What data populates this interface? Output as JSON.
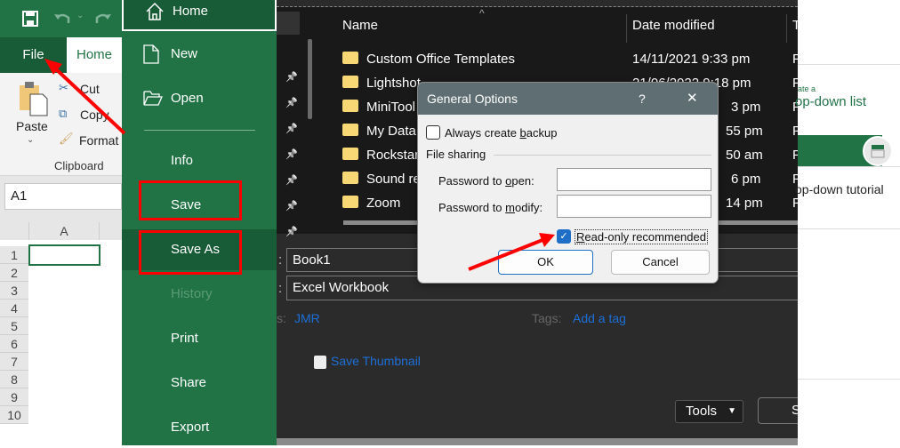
{
  "excel": {
    "tabs": {
      "file": "File",
      "home": "Home"
    },
    "ribbon": {
      "paste": "Paste",
      "cut": "Cut",
      "copy": "Copy",
      "format": "Format",
      "group": "Clipboard"
    },
    "name_box": "A1",
    "column": "A",
    "rows": [
      "1",
      "2",
      "3",
      "4",
      "5",
      "6",
      "7",
      "8",
      "9",
      "10"
    ]
  },
  "backstage": {
    "items": [
      {
        "label": "Home",
        "icon": "home-icon"
      },
      {
        "label": "New",
        "icon": "new-document-icon"
      },
      {
        "label": "Open",
        "icon": "open-folder-icon"
      },
      {
        "label": "Info"
      },
      {
        "label": "Save"
      },
      {
        "label": "Save As"
      },
      {
        "label": "History"
      },
      {
        "label": "Print"
      },
      {
        "label": "Share"
      },
      {
        "label": "Export"
      }
    ],
    "selected": "Save As",
    "accent": "#217346"
  },
  "save_dialog": {
    "columns": {
      "name": "Name",
      "date": "Date modified",
      "type": "T"
    },
    "files": [
      {
        "name": "Custom Office Templates",
        "date": "14/11/2021 9:33 pm",
        "type": "F"
      },
      {
        "name": "Lightshot",
        "date": "21/06/2022 9:18 pm",
        "type": "F"
      },
      {
        "name": "MiniTool",
        "date": "3 pm",
        "type": "F"
      },
      {
        "name": "My Data",
        "date": "55 pm",
        "type": "F"
      },
      {
        "name": "Rockstar",
        "date": "50 am",
        "type": "F"
      },
      {
        "name": "Sound re",
        "date": "6 pm",
        "type": "F"
      },
      {
        "name": "Zoom",
        "date": "14 pm",
        "type": "F"
      }
    ],
    "file_name": "Book1",
    "save_as_type": "Excel Workbook",
    "authors_label": "s:",
    "authors": "JMR",
    "tags_label": "Tags:",
    "tags": "Add a tag",
    "save_thumbnail": "Save Thumbnail",
    "tools": "Tools",
    "save": "S",
    "field_colon": ":"
  },
  "right_panel": {
    "small": "ate a",
    "title": "op-down list",
    "tutorial": "op-down tutorial"
  },
  "general_options": {
    "title": "General Options",
    "help": "?",
    "close": "✕",
    "always_backup": "Always create backup",
    "always_backup_checked": false,
    "file_sharing": "File sharing",
    "password_open_label": "Password to open:",
    "password_open": "",
    "password_modify_label": "Password to modify:",
    "password_modify": "",
    "read_only": "Read-only recommended",
    "read_only_checked": true,
    "ok": "OK",
    "cancel": "Cancel"
  }
}
